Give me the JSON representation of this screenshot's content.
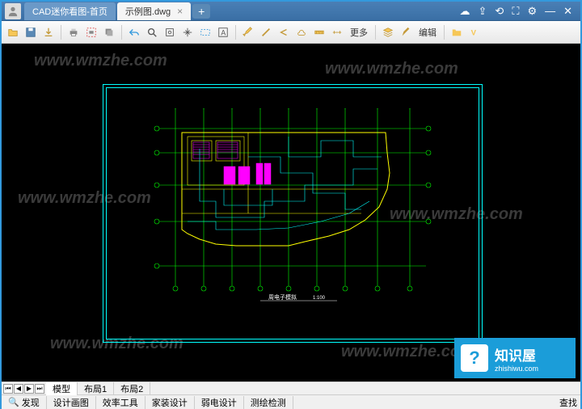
{
  "tabs": {
    "t1": "CAD迷你看图-首页",
    "t2": "示例图.dwg"
  },
  "toolbar": {
    "more": "更多",
    "edit": "编辑"
  },
  "watermark": "www.wmzhe.com",
  "drawing": {
    "title": "周电子模拟",
    "scale": "1:100"
  },
  "nav": {
    "model": "模型",
    "layout1": "布局1",
    "layout2": "布局2"
  },
  "status": {
    "discover": "发现",
    "design": "设计画图",
    "tools": "效率工具",
    "decoration": "家装设计",
    "electrical": "弱电设计",
    "survey": "测绘检测",
    "right": "查找"
  },
  "brand": {
    "cn": "知识屋",
    "en": "zhishiwu.com",
    "icon": "?"
  }
}
